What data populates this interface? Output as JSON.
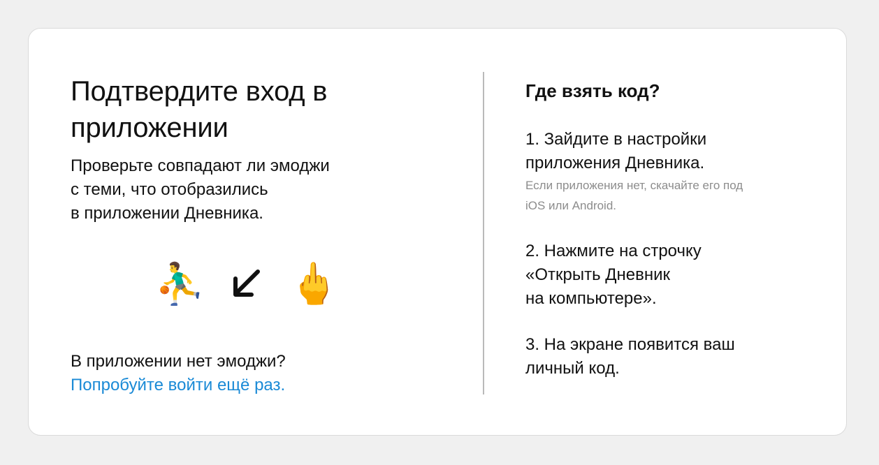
{
  "left": {
    "title_line1": "Подтвердите вход в",
    "title_line2": "приложении",
    "subtitle_line1": "Проверьте совпадают ли эмоджи",
    "subtitle_line2": "с теми, что отобразились",
    "subtitle_line3": "в приложении Дневника.",
    "emojis": [
      "⛹️‍♂️",
      "↙️",
      "🖕"
    ],
    "no_emoji_text": "В приложении нет эмоджи?",
    "retry_link": "Попробуйте войти ещё раз."
  },
  "right": {
    "heading": "Где взять код?",
    "step1_line1": "1. Зайдите в настройки",
    "step1_line2": "приложения Дневника.",
    "step1_note_line1": "Если приложения нет, скачайте его под",
    "step1_note_line2": "iOS или Android.",
    "step2_line1": "2. Нажмите на строчку",
    "step2_line2": "«Открыть Дневник",
    "step2_line3": "на компьютере».",
    "step3_line1": "3. На экране появится ваш",
    "step3_line2": "личный код."
  },
  "colors": {
    "link": "#1a8ad6",
    "note": "#8c8c8c",
    "divider": "#b9b9b9",
    "background": "#f0f0f0"
  }
}
